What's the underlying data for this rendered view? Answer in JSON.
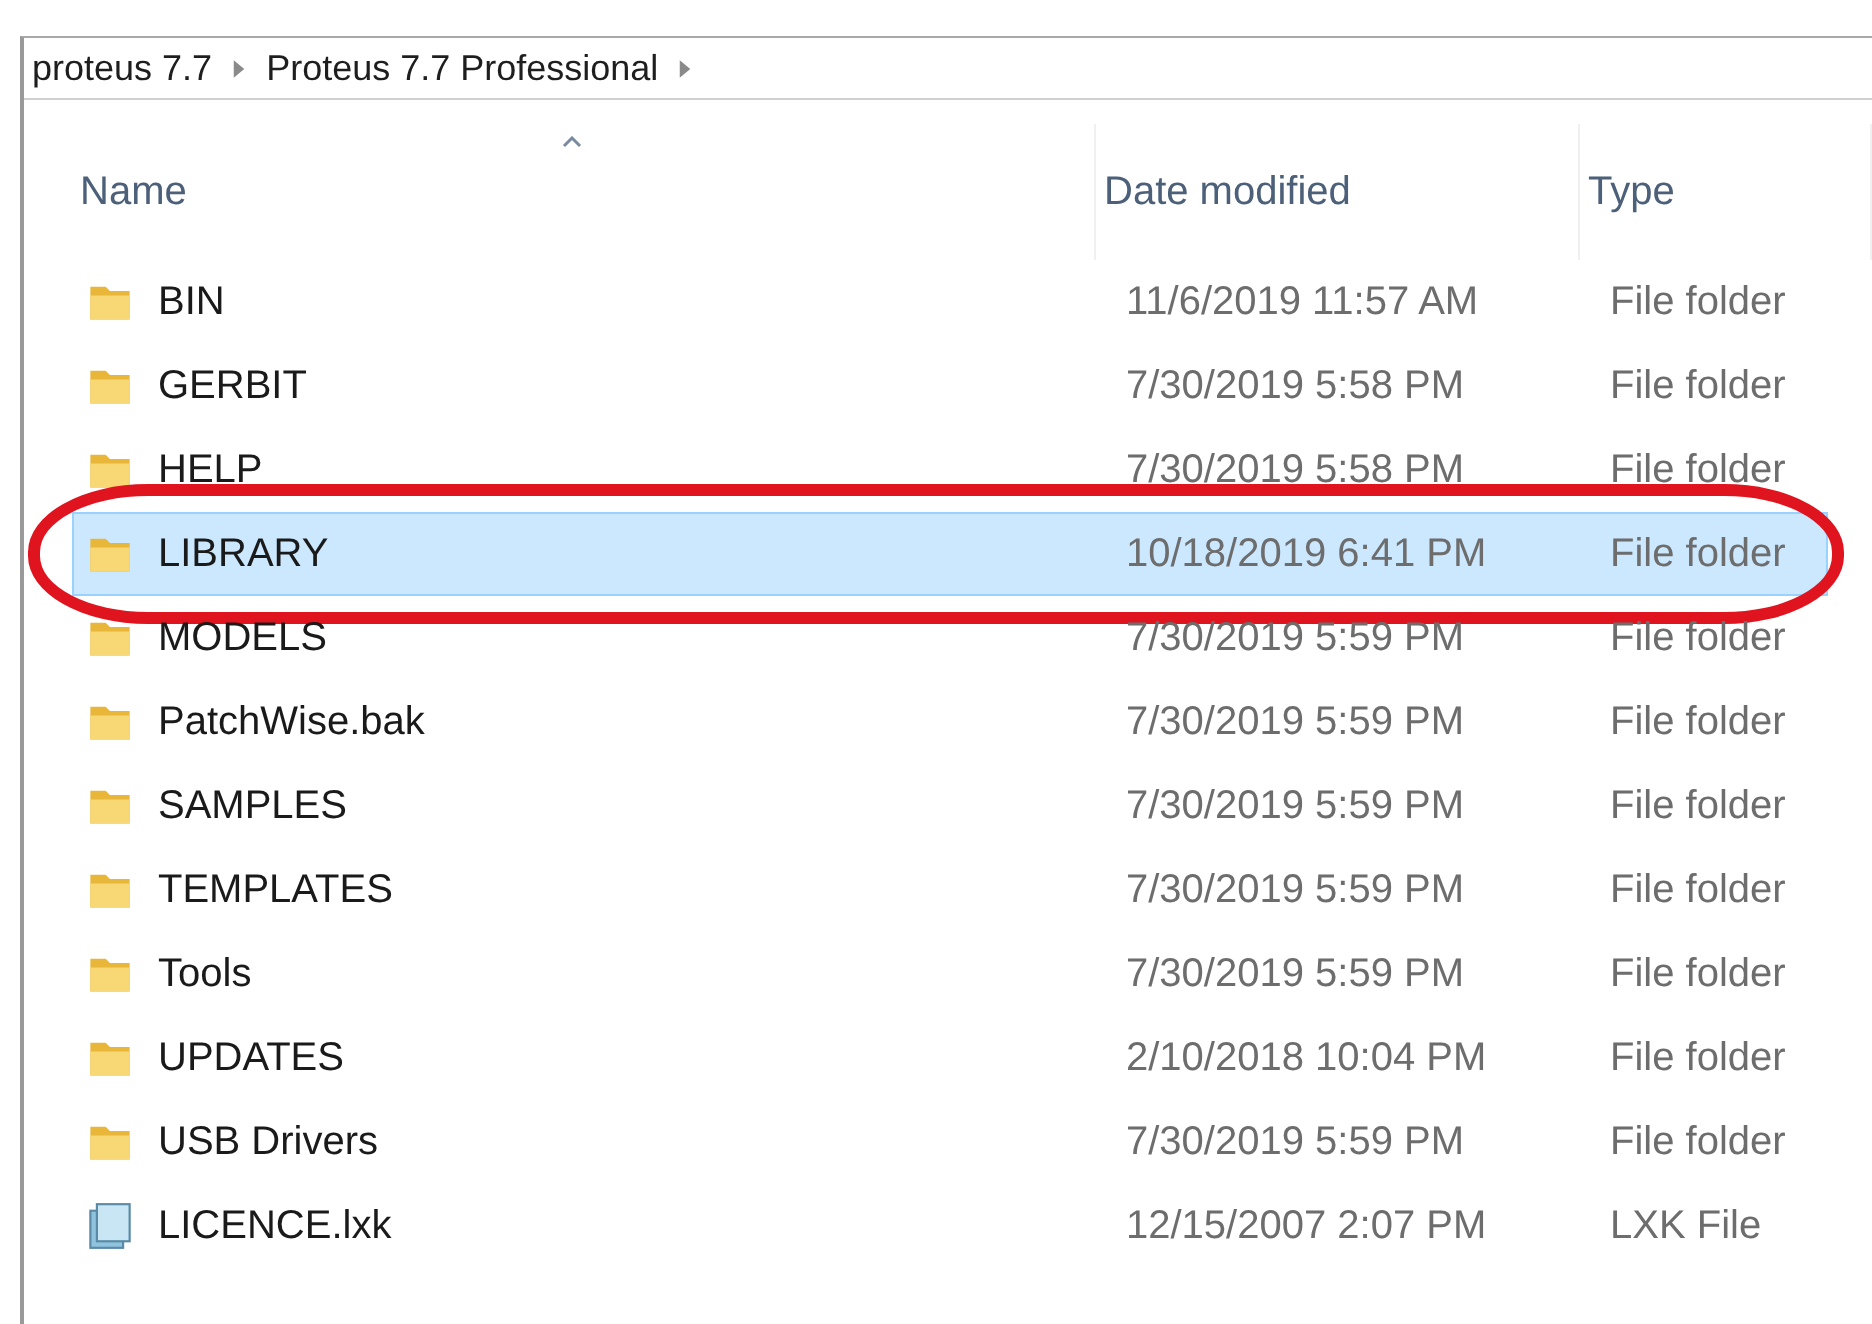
{
  "breadcrumb": [
    {
      "label": "proteus 7.7"
    },
    {
      "label": "Proteus 7.7 Professional"
    }
  ],
  "columns": [
    {
      "label": "Name",
      "sorted": true
    },
    {
      "label": "Date modified",
      "sorted": false
    },
    {
      "label": "Type",
      "sorted": false
    }
  ],
  "rows": [
    {
      "kind": "folder",
      "name": "BIN",
      "date": "11/6/2019 11:57 AM",
      "type": "File folder",
      "selected": false,
      "circled": false
    },
    {
      "kind": "folder",
      "name": "GERBIT",
      "date": "7/30/2019 5:58 PM",
      "type": "File folder",
      "selected": false,
      "circled": false
    },
    {
      "kind": "folder",
      "name": "HELP",
      "date": "7/30/2019 5:58 PM",
      "type": "File folder",
      "selected": false,
      "circled": false
    },
    {
      "kind": "folder",
      "name": "LIBRARY",
      "date": "10/18/2019 6:41 PM",
      "type": "File folder",
      "selected": true,
      "circled": true
    },
    {
      "kind": "folder",
      "name": "MODELS",
      "date": "7/30/2019 5:59 PM",
      "type": "File folder",
      "selected": false,
      "circled": false
    },
    {
      "kind": "folder",
      "name": "PatchWise.bak",
      "date": "7/30/2019 5:59 PM",
      "type": "File folder",
      "selected": false,
      "circled": false
    },
    {
      "kind": "folder",
      "name": "SAMPLES",
      "date": "7/30/2019 5:59 PM",
      "type": "File folder",
      "selected": false,
      "circled": false
    },
    {
      "kind": "folder",
      "name": "TEMPLATES",
      "date": "7/30/2019 5:59 PM",
      "type": "File folder",
      "selected": false,
      "circled": false
    },
    {
      "kind": "folder",
      "name": "Tools",
      "date": "7/30/2019 5:59 PM",
      "type": "File folder",
      "selected": false,
      "circled": false
    },
    {
      "kind": "folder",
      "name": "UPDATES",
      "date": "2/10/2018 10:04 PM",
      "type": "File folder",
      "selected": false,
      "circled": false
    },
    {
      "kind": "folder",
      "name": "USB Drivers",
      "date": "7/30/2019 5:59 PM",
      "type": "File folder",
      "selected": false,
      "circled": false
    },
    {
      "kind": "file",
      "name": "LICENCE.lxk",
      "date": "12/15/2007 2:07 PM",
      "type": "LXK File",
      "selected": false,
      "circled": false
    }
  ]
}
